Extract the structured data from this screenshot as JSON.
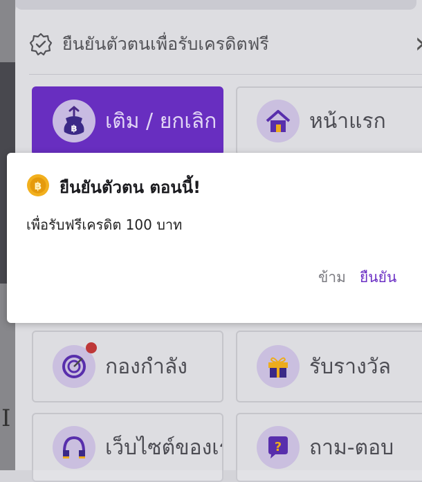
{
  "verify_banner": {
    "label": "ยืนยันตัวตนเพื่อรับเครดิตฟรี",
    "icon": "verified-badge-icon"
  },
  "menu": {
    "items": [
      {
        "label": "เติม / ยกเลิก",
        "icon": "money-bag-icon"
      },
      {
        "label": "หน้าแรก",
        "icon": "home-icon"
      },
      {
        "label": "กองกำลัง",
        "icon": "target-icon"
      },
      {
        "label": "รับรางวัล",
        "icon": "gift-icon"
      },
      {
        "label": "เว็บไซต์ของเรา",
        "icon": "headphones-icon"
      },
      {
        "label": "ถาม-ตอบ",
        "icon": "question-icon"
      }
    ]
  },
  "dialog": {
    "title": "ยืนยันตัวตน ตอนนี้!",
    "message": "เพื่อรับฟรีเครดิต 100 บาท",
    "skip_label": "ข้าม",
    "confirm_label": "ยืนยัน"
  },
  "colors": {
    "accent": "#6b2fc4",
    "coin": "#f2b01e",
    "badge_dot": "#c23a3a"
  }
}
